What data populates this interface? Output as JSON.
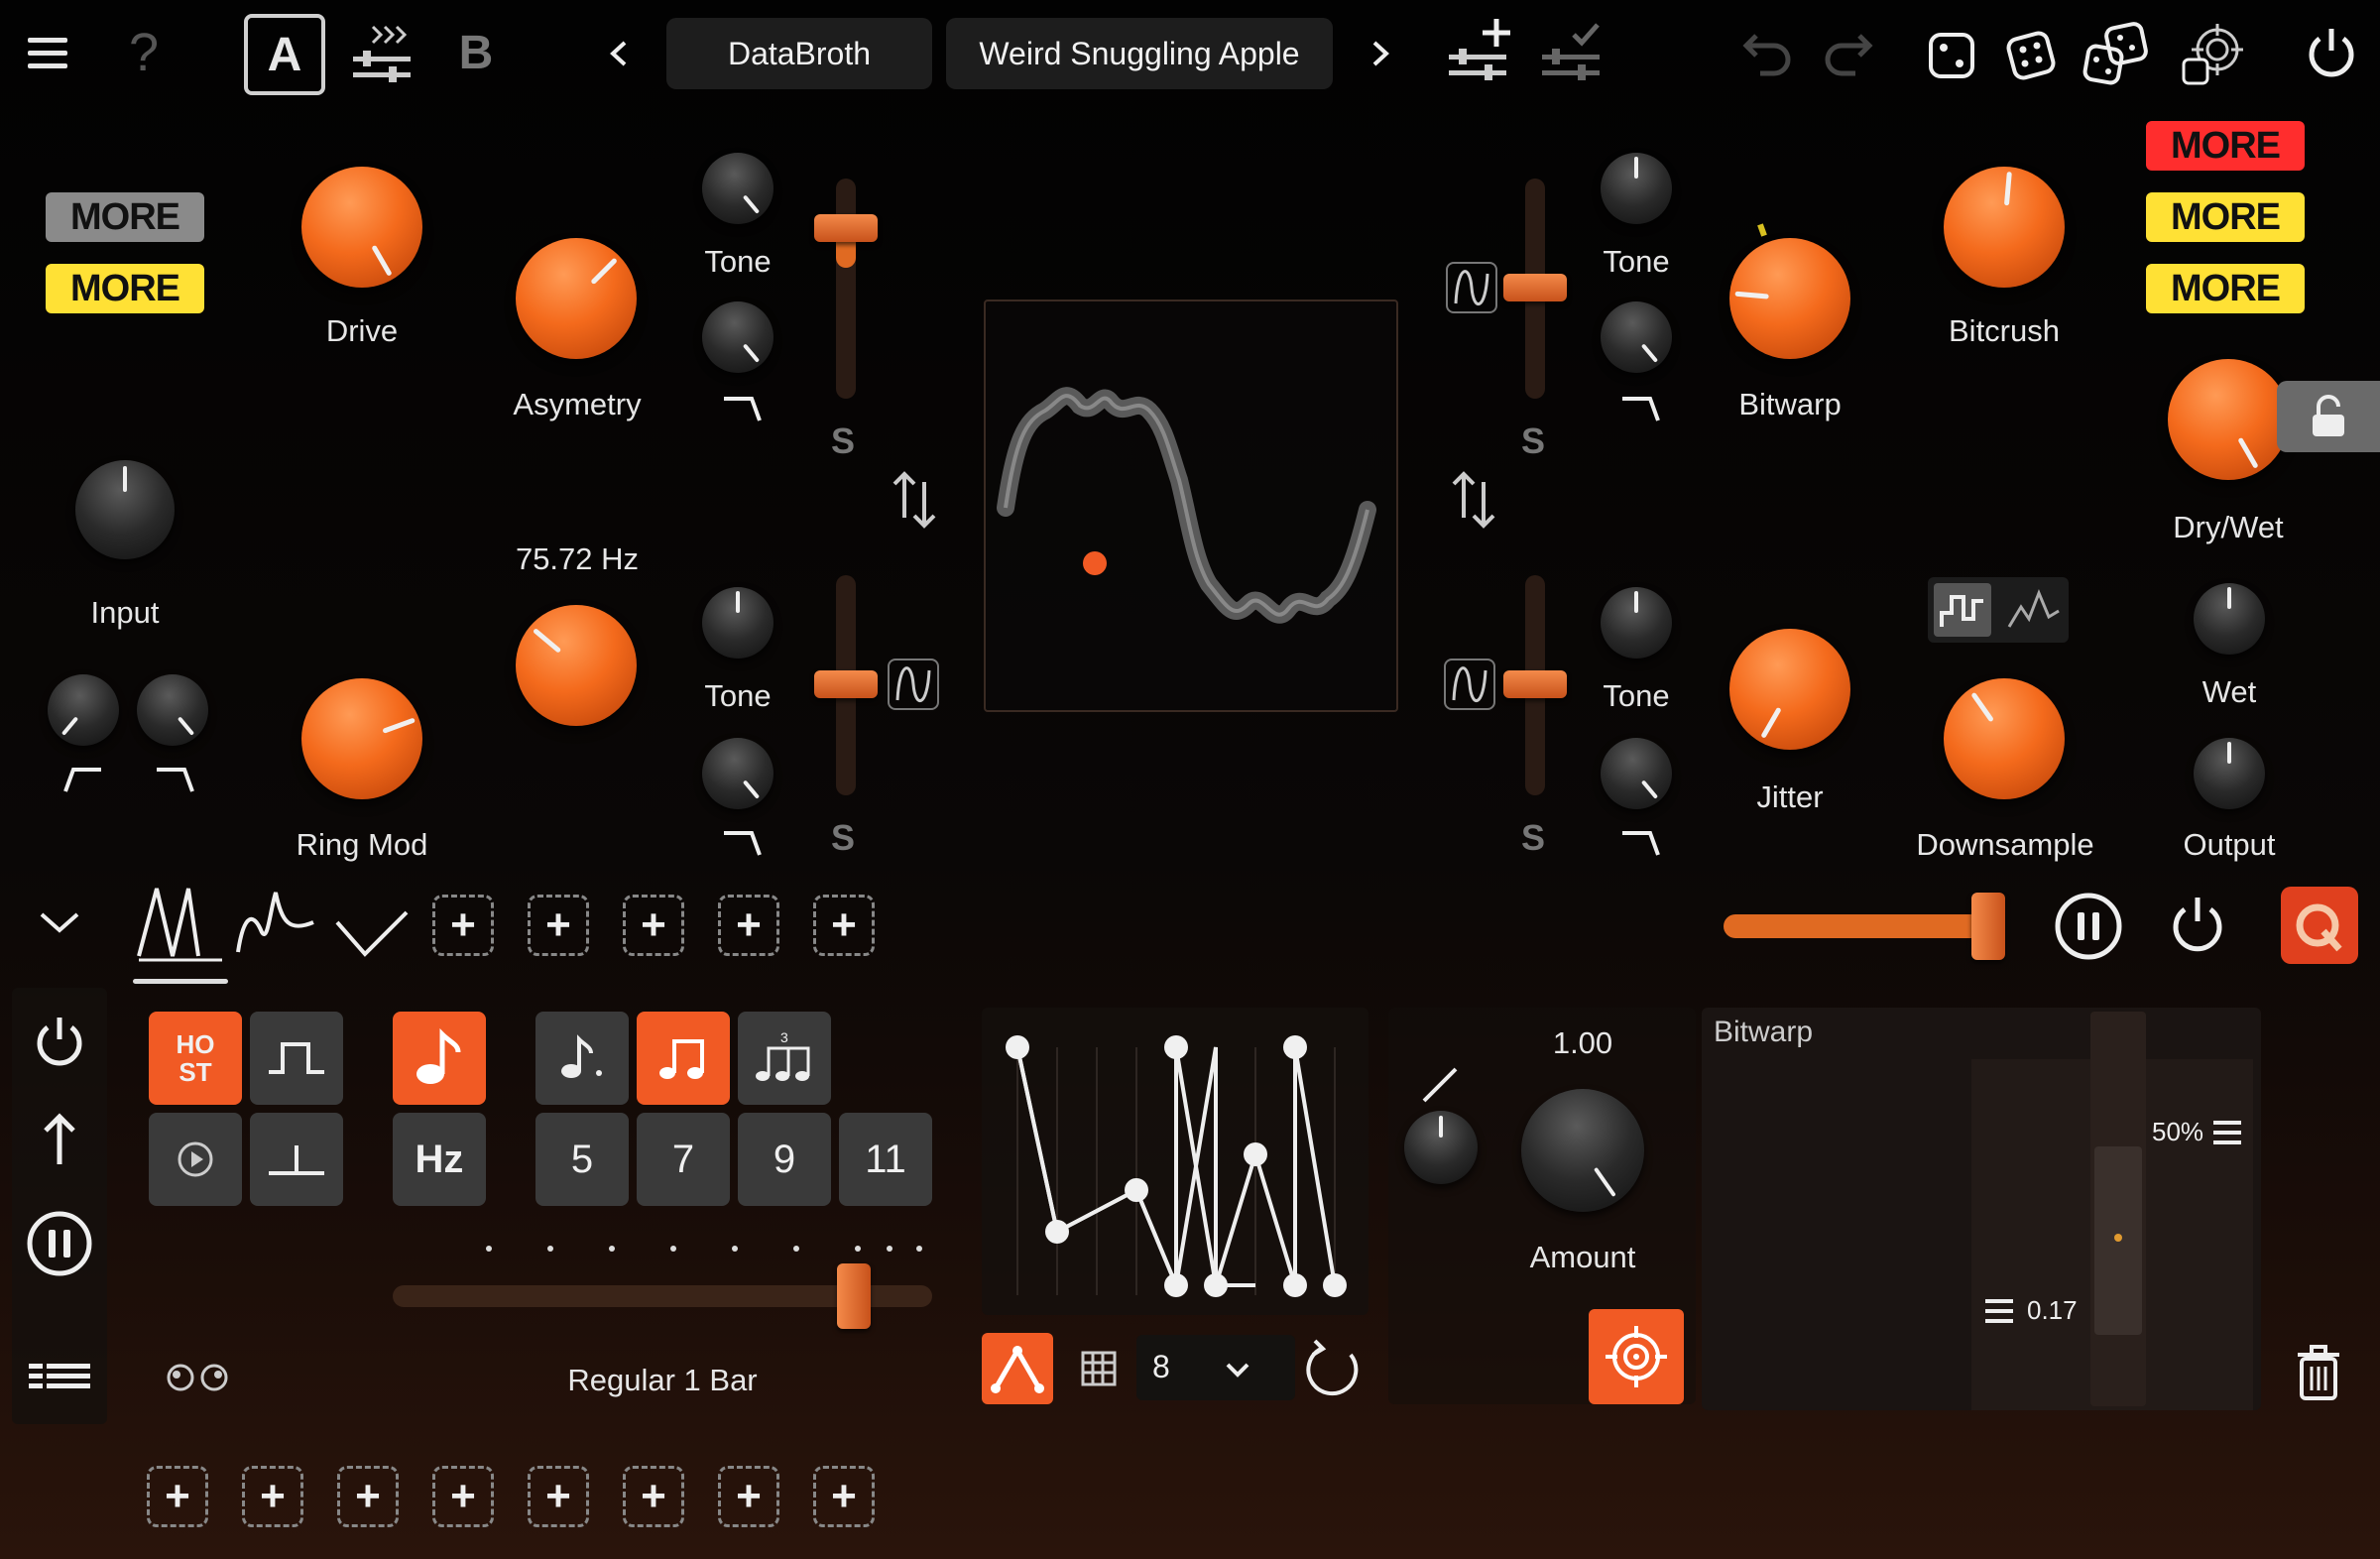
{
  "toolbar": {
    "menu_icon": "hamburger-icon",
    "help": "?",
    "slot_a": "A",
    "slot_b": "B",
    "preset_bank": "DataBroth",
    "preset_name": "Weird Snuggling Apple"
  },
  "more_buttons": {
    "left_gray": "MORE",
    "left_yellow": "MORE",
    "right_red": "MORE",
    "right_yellow_1": "MORE",
    "right_yellow_2": "MORE"
  },
  "knobs": {
    "drive": "Drive",
    "asymetry": "Asymetry",
    "input": "Input",
    "ring_mod": "Ring Mod",
    "ring_mod_freq": "75.72 Hz",
    "bitwarp": "Bitwarp",
    "bitcrush": "Bitcrush",
    "dry_wet": "Dry/Wet",
    "jitter": "Jitter",
    "downsample": "Downsample",
    "wet": "Wet",
    "output": "Output",
    "amount": "Amount",
    "amount_value": "1.00"
  },
  "tone_labels": {
    "t1": "Tone",
    "t2": "Tone",
    "t3": "Tone",
    "t4": "Tone"
  },
  "s_labels": {
    "s1": "S",
    "s2": "S",
    "s3": "S",
    "s4": "S"
  },
  "lfo": {
    "host": "HO ST",
    "hz": "Hz",
    "num_5": "5",
    "num_7": "7",
    "num_9": "9",
    "num_11": "11",
    "rate_label": "Regular 1 Bar",
    "steps": "8"
  },
  "mod_panel": {
    "title": "Bitwarp",
    "pct": "50%",
    "value": "0.17"
  },
  "colors": {
    "accent": "#f15a24",
    "more_red": "#ff2d2d",
    "more_yellow": "#ffe135",
    "more_gray": "#8a8a8a"
  }
}
